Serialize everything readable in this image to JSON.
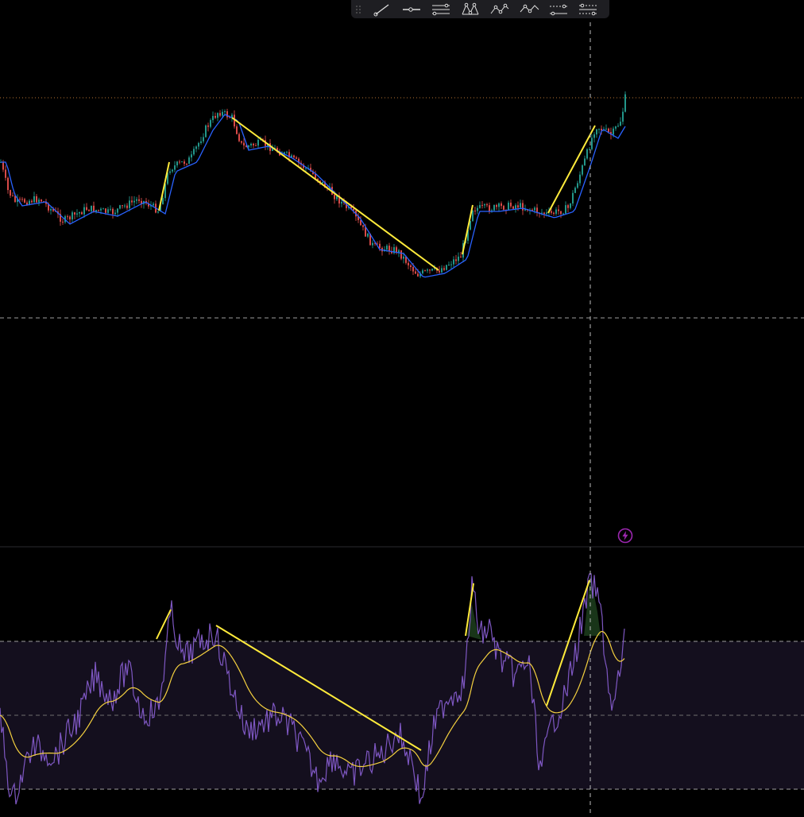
{
  "toolbar": {
    "tools": [
      {
        "name": "trend-line-tool-icon"
      },
      {
        "name": "horizontal-ray-tool-icon"
      },
      {
        "name": "parallel-channel-tool-icon"
      },
      {
        "name": "pattern-tool-icon"
      },
      {
        "name": "elliott-wave-tool-icon"
      },
      {
        "name": "path-tool-icon"
      },
      {
        "name": "range-tool-icon"
      },
      {
        "name": "regression-tool-icon"
      }
    ]
  },
  "alert_icon": {
    "name": "lightning-alert-icon",
    "color": "#9c27b0"
  },
  "colors": {
    "up_candle": "#26a69a",
    "down_candle": "#ef5350",
    "ma_line": "#2962ff",
    "trendline": "#ffeb3b",
    "oscillator": "#7e57c2",
    "signal": "#f4d03f",
    "band_fill": "#140f1e",
    "grid_dash": "#9e9e9e",
    "crosshair": "#bdbdbd",
    "price_level": "#b87333"
  },
  "chart_data": [
    {
      "type": "candlestick",
      "series": [
        {
          "values": []
        }
      ],
      "ma_overlay": true,
      "price_level_line": true,
      "divergence_lines": 4
    },
    {
      "type": "line",
      "series": [
        {
          "values": []
        },
        {
          "values": []
        }
      ],
      "band_levels": [
        30,
        50,
        70
      ],
      "divergence_lines": 4
    }
  ]
}
